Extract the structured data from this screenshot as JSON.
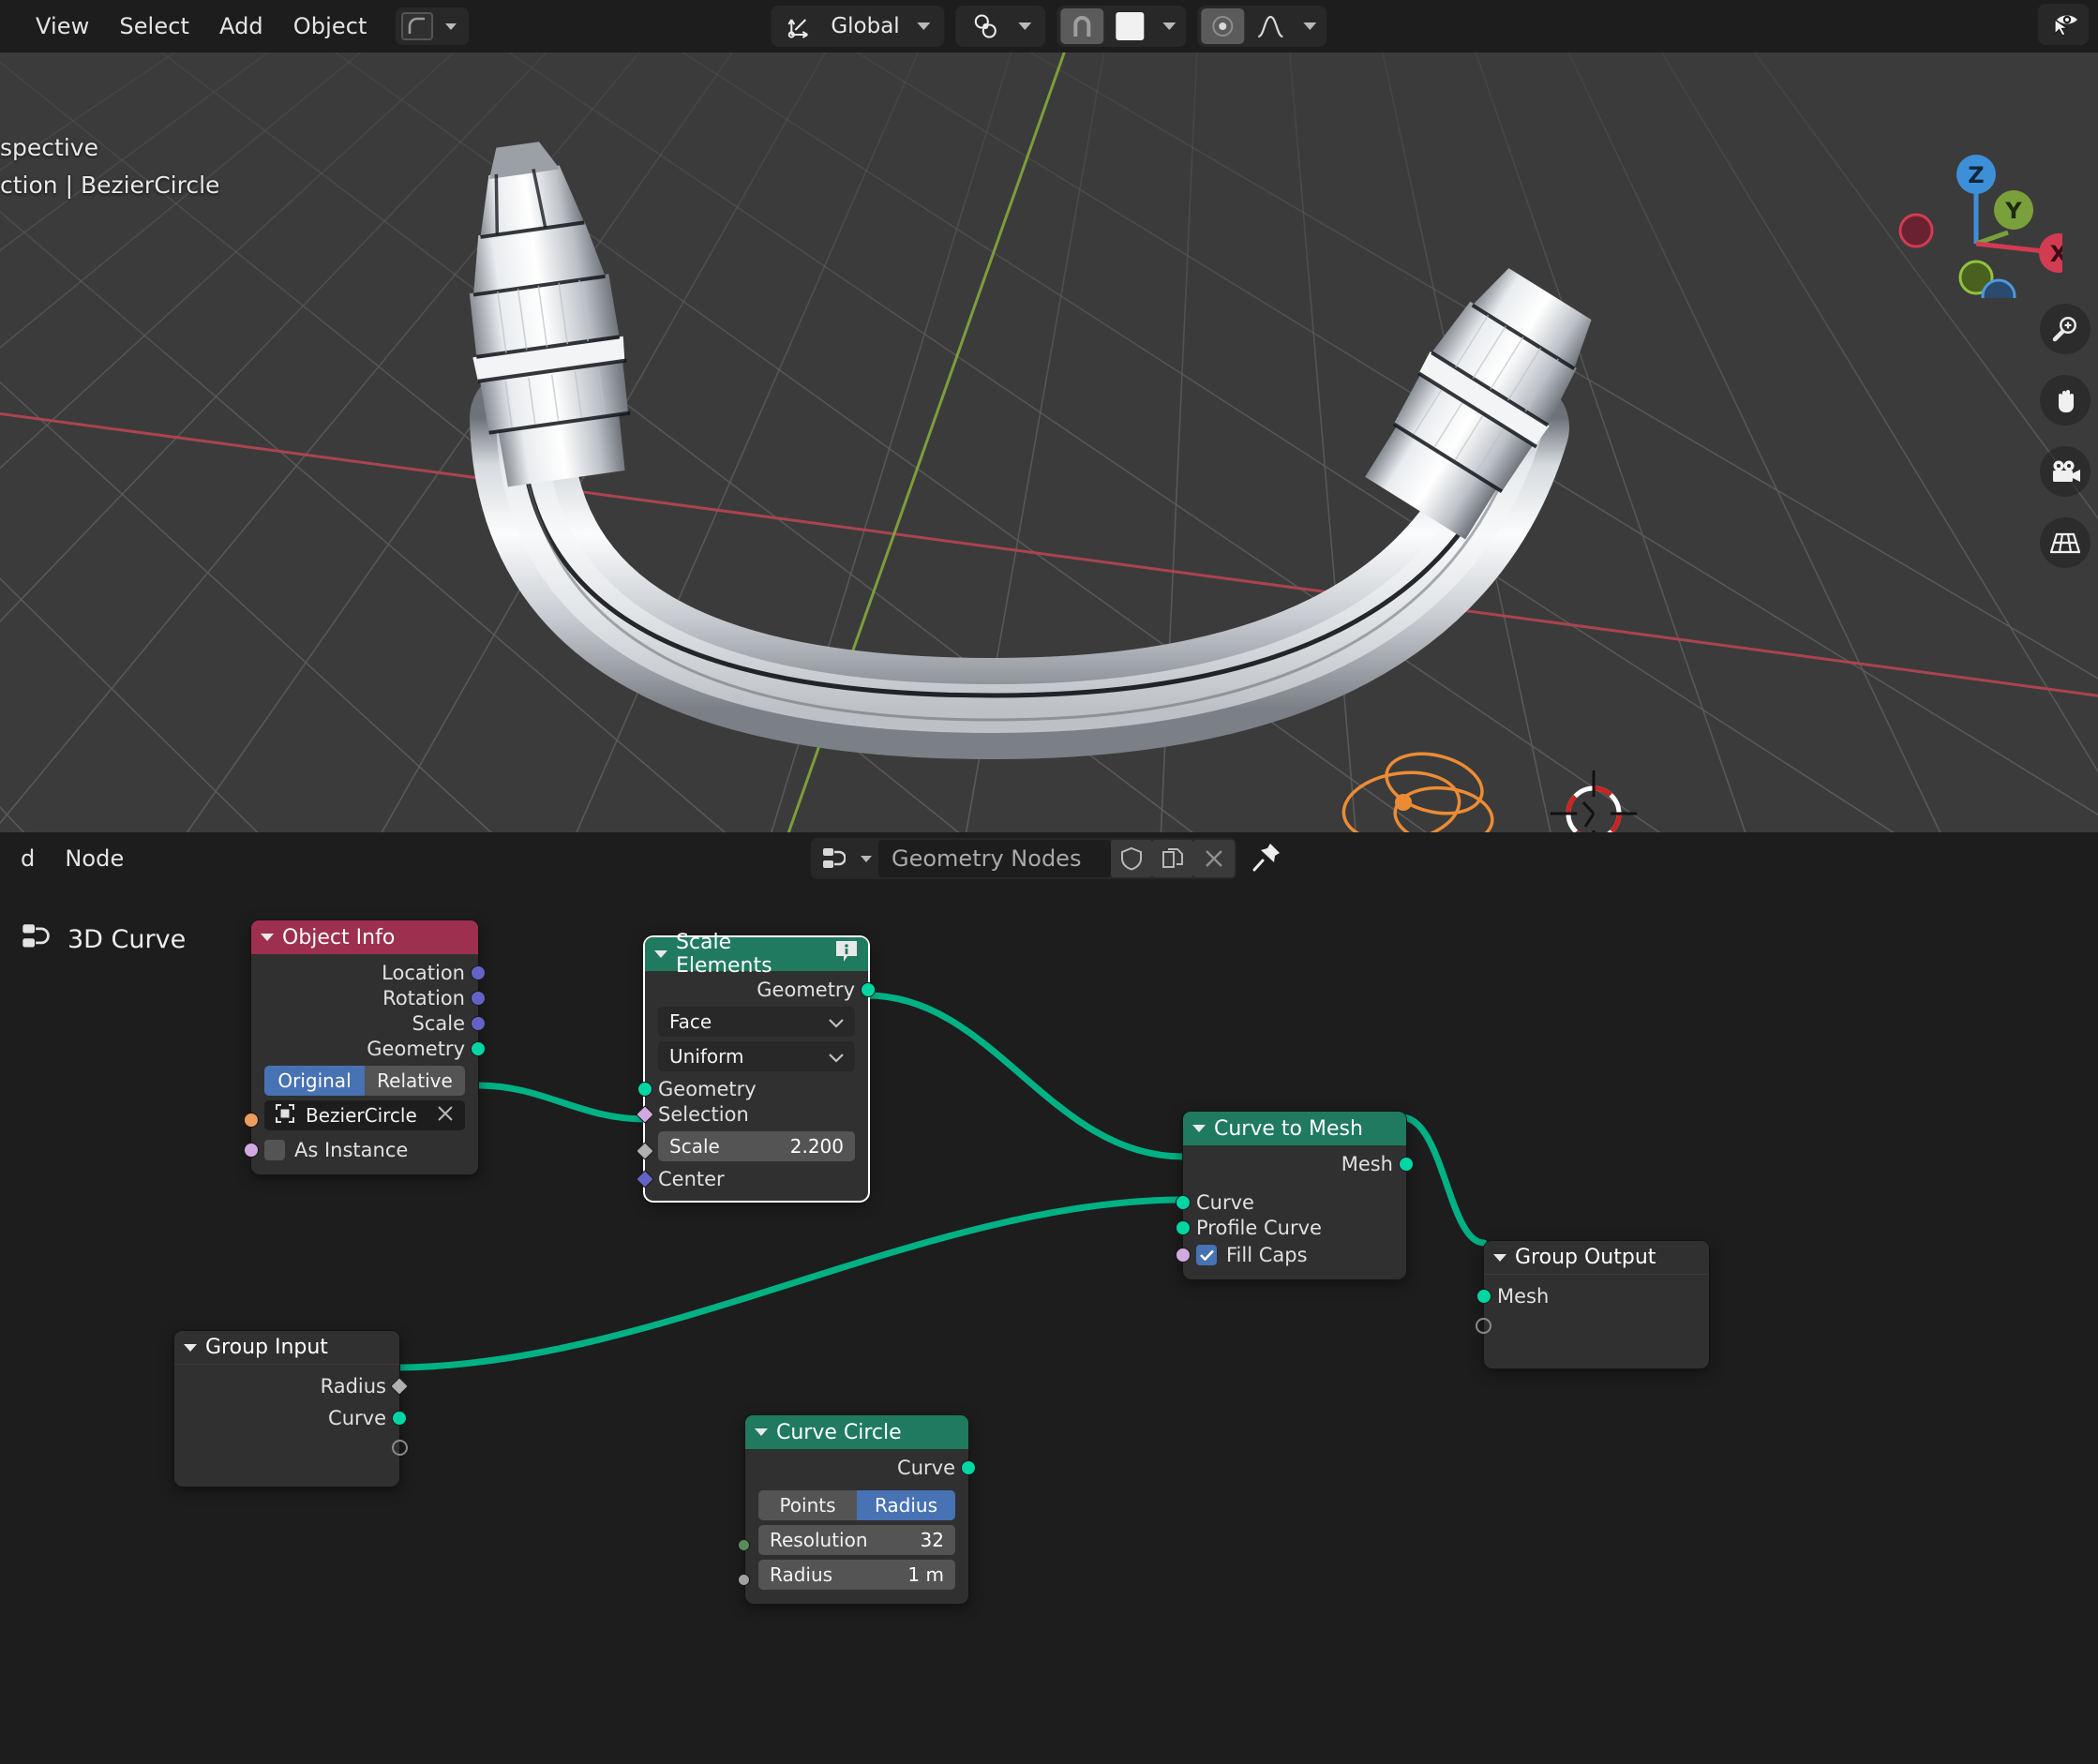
{
  "viewport_header": {
    "menus": [
      {
        "label": "View",
        "name": "menu-view"
      },
      {
        "label": "Select",
        "name": "menu-select"
      },
      {
        "label": "Add",
        "name": "menu-add"
      },
      {
        "label": "Object",
        "name": "menu-object"
      }
    ],
    "mode_icon": "curve-falloff-icon",
    "transform_orientation": "Global",
    "orientation_icon": "transform-orientation-icon",
    "snap_icon": "snap-magnet-icon",
    "snap_target_icon": "snap-increment-swatch",
    "proportional_icon": "proportional-editing-icon",
    "falloff_icon": "smooth-falloff-icon",
    "visibility_icon": "viewport-visibility-icon"
  },
  "viewport": {
    "overlay_lines": [
      "spective",
      "ction | BezierCircle"
    ],
    "gizmo_axes": [
      "Z",
      "Y",
      "X"
    ],
    "nav_icons": [
      "zoom-icon",
      "pan-hand-icon",
      "camera-icon",
      "grid-toggle-icon"
    ],
    "object_name": "BezierCircle",
    "colors": {
      "background": "#3b3b3b",
      "grid": "#555555",
      "axis_x": "#b74a52",
      "axis_y": "#7aa03c",
      "selection_outline": "#eb8c34",
      "cursor_red": "#cc3333"
    }
  },
  "node_editor_header": {
    "menus": [
      {
        "label": "d",
        "name": "menu-add-truncated"
      },
      {
        "label": "Node",
        "name": "menu-node"
      }
    ],
    "datablock_icon": "geometry-nodes-icon",
    "datablock_name": "Geometry Nodes",
    "shield_icon": "fake-user-shield-icon",
    "copy_icon": "new-copy-icon",
    "close_icon": "unlink-x-icon",
    "pin_icon": "pin-icon"
  },
  "node_canvas": {
    "breadcrumb_icon": "geometry-nodes-icon",
    "breadcrumb_label": "3D Curve",
    "colors": {
      "link_geometry": "#00b184",
      "header_geometry": "#1f7a60",
      "header_input": "#9d2f4f",
      "header_group": "#303030",
      "socket_geometry": "#00d6a3",
      "socket_vector": "#6363c7",
      "socket_field": "#d2a9e0",
      "socket_object": "#ed9e5c",
      "socket_float": "#a1a1a1",
      "socket_int": "#598c5c",
      "accent_blue": "#4772b3"
    },
    "nodes": [
      {
        "id": "object-info",
        "title": "Object Info",
        "header_color": "#9d2f4f",
        "selected": false,
        "outputs": [
          {
            "label": "Location",
            "socket": "vector"
          },
          {
            "label": "Rotation",
            "socket": "vector"
          },
          {
            "label": "Scale",
            "socket": "vector"
          },
          {
            "label": "Geometry",
            "socket": "geometry"
          }
        ],
        "toggle": {
          "options": [
            "Original",
            "Relative"
          ],
          "selected": "Original"
        },
        "object_field": {
          "icon": "object-data-icon",
          "value": "BezierCircle",
          "clear_icon": "x-icon"
        },
        "checkbox": {
          "label": "As Instance",
          "checked": false
        }
      },
      {
        "id": "scale-elements",
        "title": "Scale Elements",
        "header_color": "#1f7a60",
        "selected": true,
        "badge_icon": "info-badge-icon",
        "outputs": [
          {
            "label": "Geometry",
            "socket": "geometry"
          }
        ],
        "dropdowns": [
          "Face",
          "Uniform"
        ],
        "inputs": [
          {
            "label": "Geometry",
            "socket": "geometry"
          },
          {
            "label": "Selection",
            "socket": "field"
          },
          {
            "label": "Scale",
            "socket": "float-field",
            "value": "2.200",
            "is_widget": true
          },
          {
            "label": "Center",
            "socket": "vector"
          }
        ]
      },
      {
        "id": "curve-to-mesh",
        "title": "Curve to Mesh",
        "header_color": "#1f7a60",
        "selected": false,
        "outputs": [
          {
            "label": "Mesh",
            "socket": "geometry"
          }
        ],
        "inputs": [
          {
            "label": "Curve",
            "socket": "geometry"
          },
          {
            "label": "Profile Curve",
            "socket": "geometry"
          },
          {
            "label": "Fill Caps",
            "socket": "field",
            "checked": true,
            "is_checkbox": true
          }
        ]
      },
      {
        "id": "group-output",
        "title": "Group Output",
        "header_color": "#303030",
        "selected": false,
        "inputs": [
          {
            "label": "Mesh",
            "socket": "geometry"
          },
          {
            "label": "",
            "socket": "empty"
          }
        ]
      },
      {
        "id": "group-input",
        "title": "Group Input",
        "header_color": "#303030",
        "selected": false,
        "outputs": [
          {
            "label": "Radius",
            "socket": "float-field"
          },
          {
            "label": "Curve",
            "socket": "geometry"
          },
          {
            "label": "",
            "socket": "empty"
          }
        ]
      },
      {
        "id": "curve-circle",
        "title": "Curve Circle",
        "header_color": "#1f7a60",
        "selected": false,
        "outputs": [
          {
            "label": "Curve",
            "socket": "geometry"
          }
        ],
        "toggle": {
          "options": [
            "Points",
            "Radius"
          ],
          "selected": "Radius"
        },
        "inputs": [
          {
            "label": "Resolution",
            "socket": "int",
            "value": "32",
            "is_widget": true
          },
          {
            "label": "Radius",
            "socket": "float",
            "value": "1 m",
            "is_widget": true
          }
        ]
      }
    ]
  }
}
